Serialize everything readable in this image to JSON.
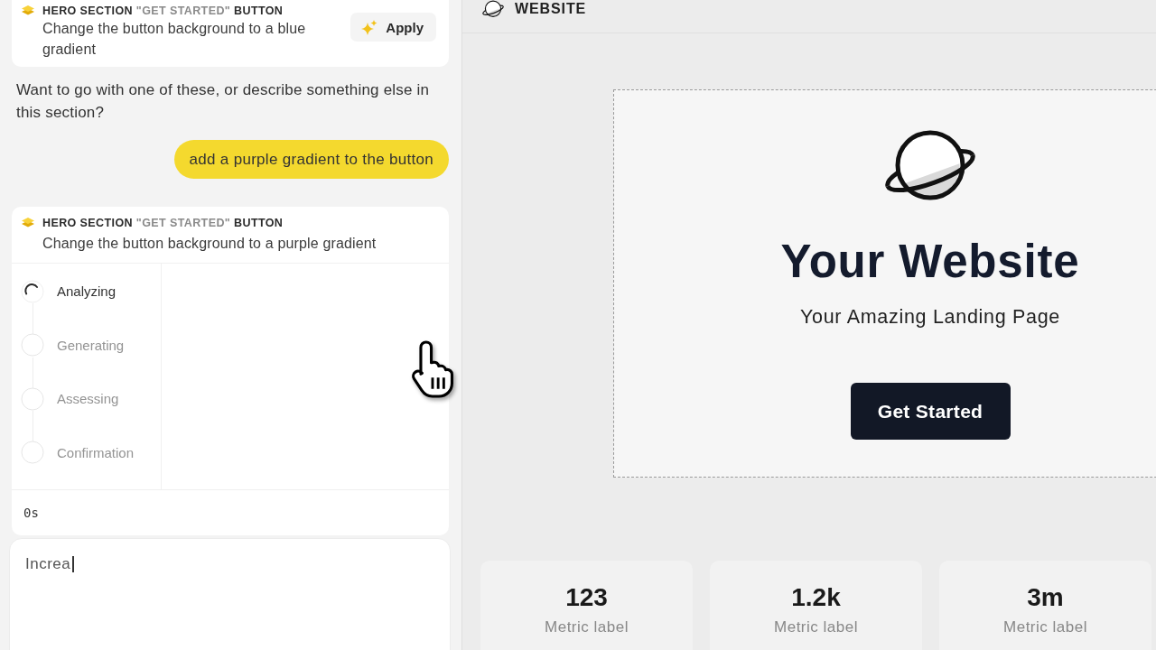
{
  "chat": [
    {
      "kind": "suggestion",
      "target": {
        "section": "HERO SECTION",
        "name": "\"GET STARTED\"",
        "type": "BUTTON"
      },
      "description": "Change the button background to a blue gradient",
      "action": "Apply"
    },
    {
      "kind": "assistant",
      "text": "Want to go with one of these, or describe something else in this section?"
    },
    {
      "kind": "user",
      "text": "add a purple gradient to the button"
    },
    {
      "kind": "task",
      "target": {
        "section": "HERO SECTION",
        "name": "\"GET STARTED\"",
        "type": "BUTTON"
      },
      "description": "Change the button background to a purple gradient",
      "steps": [
        {
          "label": "Analyzing",
          "active": true
        },
        {
          "label": "Generating",
          "active": false
        },
        {
          "label": "Assessing",
          "active": false
        },
        {
          "label": "Confirmation",
          "active": false
        }
      ],
      "elapsed": "0s"
    }
  ],
  "composer": {
    "value": "Increa",
    "focused": true
  },
  "preview": {
    "title": "WEBSITE",
    "hero": {
      "heading": "Your Website",
      "subheading": "Your Amazing Landing Page",
      "button": "Get Started"
    },
    "metrics": [
      {
        "value": "123",
        "label": "Metric label"
      },
      {
        "value": "1.2k",
        "label": "Metric label"
      },
      {
        "value": "3m",
        "label": "Metric label"
      }
    ]
  }
}
